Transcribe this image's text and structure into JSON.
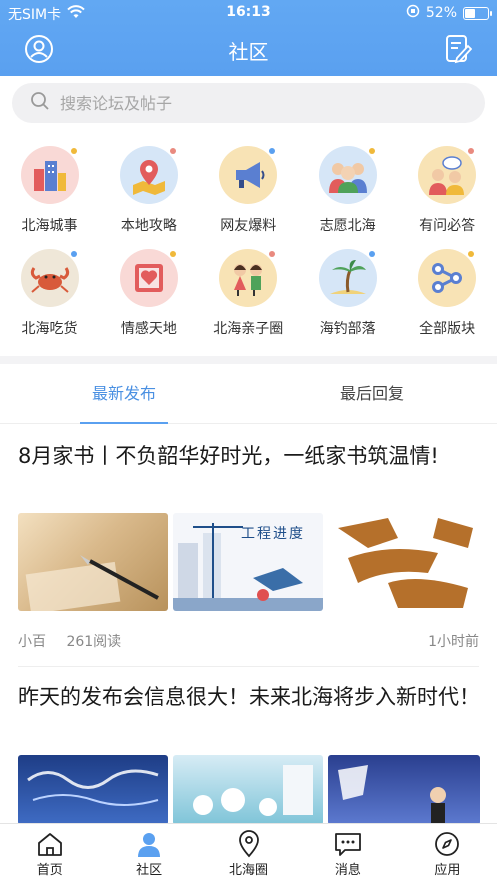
{
  "status_bar": {
    "carrier": "无SIM卡",
    "time": "16:13",
    "battery": "52%",
    "battery_level": 0.52
  },
  "header": {
    "title": "社区"
  },
  "search": {
    "placeholder": "搜索论坛及帖子"
  },
  "categories": [
    {
      "label": "北海城事",
      "icon": "city-buildings-icon",
      "bg": "#f9d9d6"
    },
    {
      "label": "本地攻略",
      "icon": "map-pin-icon",
      "bg": "#d6e6f7"
    },
    {
      "label": "网友爆料",
      "icon": "megaphone-icon",
      "bg": "#f8e3b5"
    },
    {
      "label": "志愿北海",
      "icon": "volunteers-icon",
      "bg": "#d6e6f7"
    },
    {
      "label": "有问必答",
      "icon": "qa-people-icon",
      "bg": "#f8e3b5"
    },
    {
      "label": "北海吃货",
      "icon": "crab-icon",
      "bg": "#efe7d8"
    },
    {
      "label": "情感天地",
      "icon": "heart-frame-icon",
      "bg": "#f9d9d6"
    },
    {
      "label": "北海亲子圈",
      "icon": "kids-icon",
      "bg": "#f8e3b5"
    },
    {
      "label": "海钓部落",
      "icon": "palm-island-icon",
      "bg": "#d6e6f7"
    },
    {
      "label": "全部版块",
      "icon": "molecule-icon",
      "bg": "#f8e3b5"
    }
  ],
  "tabs": [
    {
      "label": "最新发布"
    },
    {
      "label": "最后回复"
    }
  ],
  "posts": [
    {
      "title": "8月家书丨不负韶华好时光，一纸家书筑温情!",
      "thumb_captions": [
        "",
        "工程进度",
        ""
      ],
      "author": "小百",
      "reads": "261阅读",
      "time": "1小时前"
    },
    {
      "title": "昨天的发布会信息很大！未来北海将步入新时代！",
      "thumb_captions": [
        "",
        "",
        ""
      ]
    }
  ],
  "tabbar": [
    {
      "label": "首页",
      "icon": "home-icon"
    },
    {
      "label": "社区",
      "icon": "community-person-icon"
    },
    {
      "label": "北海圈",
      "icon": "location-pin-icon"
    },
    {
      "label": "消息",
      "icon": "message-bubble-icon"
    },
    {
      "label": "应用",
      "icon": "compass-icon"
    }
  ],
  "colors": {
    "brand": "#5aa0f0",
    "active_tab": "#4a90e2"
  }
}
